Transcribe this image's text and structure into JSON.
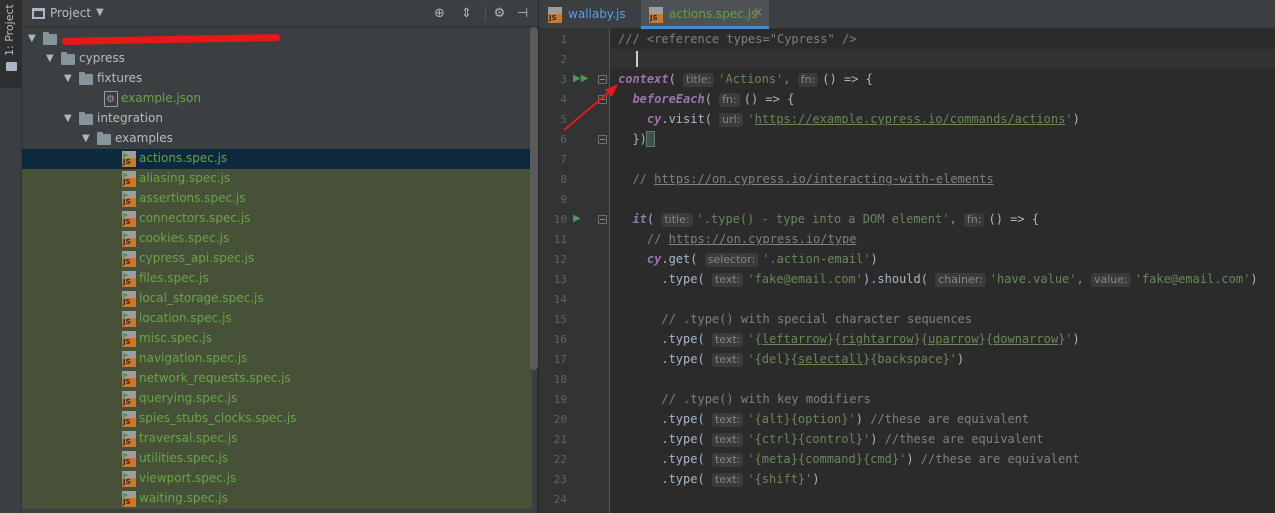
{
  "sidebar_strip": {
    "label": "1: Project"
  },
  "project_panel": {
    "title": "Project",
    "buttons": [
      "target-icon",
      "collapse-icon",
      "gear-icon",
      "hide-icon"
    ]
  },
  "tree": [
    {
      "label": "",
      "indent": 0,
      "type": "folder",
      "expanded": true,
      "redacted": true
    },
    {
      "label": "cypress",
      "indent": 1,
      "type": "folder",
      "expanded": true
    },
    {
      "label": "fixtures",
      "indent": 2,
      "type": "folder",
      "expanded": true
    },
    {
      "label": "example.json",
      "indent": 3,
      "type": "json"
    },
    {
      "label": "integration",
      "indent": 2,
      "type": "folder",
      "expanded": true
    },
    {
      "label": "examples",
      "indent": 3,
      "type": "folder",
      "expanded": true
    },
    {
      "label": "actions.spec.js",
      "indent": 4,
      "type": "js",
      "selected": true
    },
    {
      "label": "aliasing.spec.js",
      "indent": 4,
      "type": "js"
    },
    {
      "label": "assertions.spec.js",
      "indent": 4,
      "type": "js"
    },
    {
      "label": "connectors.spec.js",
      "indent": 4,
      "type": "js"
    },
    {
      "label": "cookies.spec.js",
      "indent": 4,
      "type": "js"
    },
    {
      "label": "cypress_api.spec.js",
      "indent": 4,
      "type": "js"
    },
    {
      "label": "files.spec.js",
      "indent": 4,
      "type": "js"
    },
    {
      "label": "local_storage.spec.js",
      "indent": 4,
      "type": "js"
    },
    {
      "label": "location.spec.js",
      "indent": 4,
      "type": "js"
    },
    {
      "label": "misc.spec.js",
      "indent": 4,
      "type": "js"
    },
    {
      "label": "navigation.spec.js",
      "indent": 4,
      "type": "js"
    },
    {
      "label": "network_requests.spec.js",
      "indent": 4,
      "type": "js"
    },
    {
      "label": "querying.spec.js",
      "indent": 4,
      "type": "js"
    },
    {
      "label": "spies_stubs_clocks.spec.js",
      "indent": 4,
      "type": "js"
    },
    {
      "label": "traversal.spec.js",
      "indent": 4,
      "type": "js"
    },
    {
      "label": "utilities.spec.js",
      "indent": 4,
      "type": "js"
    },
    {
      "label": "viewport.spec.js",
      "indent": 4,
      "type": "js"
    },
    {
      "label": "waiting.spec.js",
      "indent": 4,
      "type": "js"
    }
  ],
  "tabs": [
    {
      "label": "wallaby.js",
      "active": false
    },
    {
      "label": "actions.spec.js",
      "active": true,
      "close": "×"
    }
  ],
  "colors": {
    "keyword": "#9876aa",
    "string": "#6a8759",
    "comment": "#808080",
    "testfile_bg": "#475137",
    "selected_bg": "#0d293e",
    "annotation": "#e81818"
  },
  "code_lines": [
    {
      "n": "1",
      "segs": [
        [
          "cm",
          "/// <reference types=\"Cypress\" />"
        ]
      ]
    },
    {
      "n": "2",
      "segs": [],
      "current": true
    },
    {
      "n": "3",
      "run": true,
      "fold": true,
      "segs": [
        [
          "kw",
          "context"
        ],
        [
          "p",
          "( "
        ],
        [
          "hint",
          "title:"
        ],
        [
          "str",
          "'Actions'"
        ],
        [
          "pl",
          ", "
        ],
        [
          "hint",
          "fn:"
        ],
        [
          "p",
          "() => {"
        ]
      ]
    },
    {
      "n": "4",
      "fold": true,
      "indent": "  ",
      "segs": [
        [
          "kw",
          "beforeEach"
        ],
        [
          "p",
          "( "
        ],
        [
          "hint",
          "fn:"
        ],
        [
          "p",
          "() => {"
        ]
      ]
    },
    {
      "n": "5",
      "indent": "    ",
      "segs": [
        [
          "kw2",
          "cy"
        ],
        [
          "p",
          ".visit( "
        ],
        [
          "hint",
          "url:"
        ],
        [
          "str",
          "'"
        ],
        [
          "surl",
          "https://example.cypress.io/commands/actions"
        ],
        [
          "str",
          "'"
        ],
        [
          "p",
          ")"
        ]
      ]
    },
    {
      "n": "6",
      "fold": true,
      "indent": "  ",
      "segs": [
        [
          "p",
          "})"
        ],
        [
          "brkt",
          " "
        ]
      ]
    },
    {
      "n": "7",
      "segs": []
    },
    {
      "n": "8",
      "indent": "  ",
      "segs": [
        [
          "cm",
          "// "
        ],
        [
          "url",
          "https://on.cypress.io/interacting-with-elements"
        ]
      ]
    },
    {
      "n": "9",
      "segs": []
    },
    {
      "n": "10",
      "run": true,
      "fold": true,
      "indent": "  ",
      "segs": [
        [
          "kw",
          "it"
        ],
        [
          "p",
          "( "
        ],
        [
          "hint",
          "title:"
        ],
        [
          "str",
          "'.type() - type into a DOM element'"
        ],
        [
          "pl",
          ", "
        ],
        [
          "hint",
          "fn:"
        ],
        [
          "p",
          "() => {"
        ]
      ]
    },
    {
      "n": "11",
      "indent": "    ",
      "segs": [
        [
          "cm",
          "// "
        ],
        [
          "url",
          "https://on.cypress.io/type"
        ]
      ]
    },
    {
      "n": "12",
      "indent": "    ",
      "segs": [
        [
          "kw2",
          "cy"
        ],
        [
          "p",
          ".get( "
        ],
        [
          "hint",
          "selector:"
        ],
        [
          "str",
          "'.action-email'"
        ],
        [
          "p",
          ")"
        ]
      ]
    },
    {
      "n": "13",
      "indent": "      ",
      "segs": [
        [
          "p",
          ".type( "
        ],
        [
          "hint",
          "text:"
        ],
        [
          "str",
          "'fake@email.com'"
        ],
        [
          "p",
          ").should( "
        ],
        [
          "hint",
          "chainer:"
        ],
        [
          "str",
          "'have.value'"
        ],
        [
          "pl",
          ", "
        ],
        [
          "hint",
          "value:"
        ],
        [
          "str",
          "'fake@email.com'"
        ],
        [
          "p",
          ")"
        ]
      ]
    },
    {
      "n": "14",
      "segs": []
    },
    {
      "n": "15",
      "indent": "      ",
      "segs": [
        [
          "cm",
          "// .type() with special character sequences"
        ]
      ]
    },
    {
      "n": "16",
      "indent": "      ",
      "segs": [
        [
          "p",
          ".type( "
        ],
        [
          "hint",
          "text:"
        ],
        [
          "str",
          "'{"
        ],
        [
          "surl",
          "leftarrow"
        ],
        [
          "str",
          "}{"
        ],
        [
          "surl",
          "rightarrow"
        ],
        [
          "str",
          "}{"
        ],
        [
          "surl",
          "uparrow"
        ],
        [
          "str",
          "}{"
        ],
        [
          "surl",
          "downarrow"
        ],
        [
          "str",
          "}'"
        ],
        [
          "p",
          ")"
        ]
      ]
    },
    {
      "n": "17",
      "indent": "      ",
      "segs": [
        [
          "p",
          ".type( "
        ],
        [
          "hint",
          "text:"
        ],
        [
          "str",
          "'{del}{"
        ],
        [
          "surl",
          "selectall"
        ],
        [
          "str",
          "}{backspace}'"
        ],
        [
          "p",
          ")"
        ]
      ]
    },
    {
      "n": "18",
      "segs": []
    },
    {
      "n": "19",
      "indent": "      ",
      "segs": [
        [
          "cm",
          "// .type() with key modifiers"
        ]
      ]
    },
    {
      "n": "20",
      "indent": "      ",
      "segs": [
        [
          "p",
          ".type( "
        ],
        [
          "hint",
          "text:"
        ],
        [
          "str",
          "'{alt}{option}'"
        ],
        [
          "p",
          ") "
        ],
        [
          "cm",
          "//these are equivalent"
        ]
      ]
    },
    {
      "n": "21",
      "indent": "      ",
      "segs": [
        [
          "p",
          ".type( "
        ],
        [
          "hint",
          "text:"
        ],
        [
          "str",
          "'{ctrl}{control}'"
        ],
        [
          "p",
          ") "
        ],
        [
          "cm",
          "//these are equivalent"
        ]
      ]
    },
    {
      "n": "22",
      "indent": "      ",
      "segs": [
        [
          "p",
          ".type( "
        ],
        [
          "hint",
          "text:"
        ],
        [
          "str",
          "'{meta}{command}{cmd}'"
        ],
        [
          "p",
          ") "
        ],
        [
          "cm",
          "//these are equivalent"
        ]
      ]
    },
    {
      "n": "23",
      "indent": "      ",
      "segs": [
        [
          "p",
          ".type( "
        ],
        [
          "hint",
          "text:"
        ],
        [
          "str",
          "'{shift}'"
        ],
        [
          "p",
          ")"
        ]
      ]
    },
    {
      "n": "24",
      "segs": []
    }
  ]
}
